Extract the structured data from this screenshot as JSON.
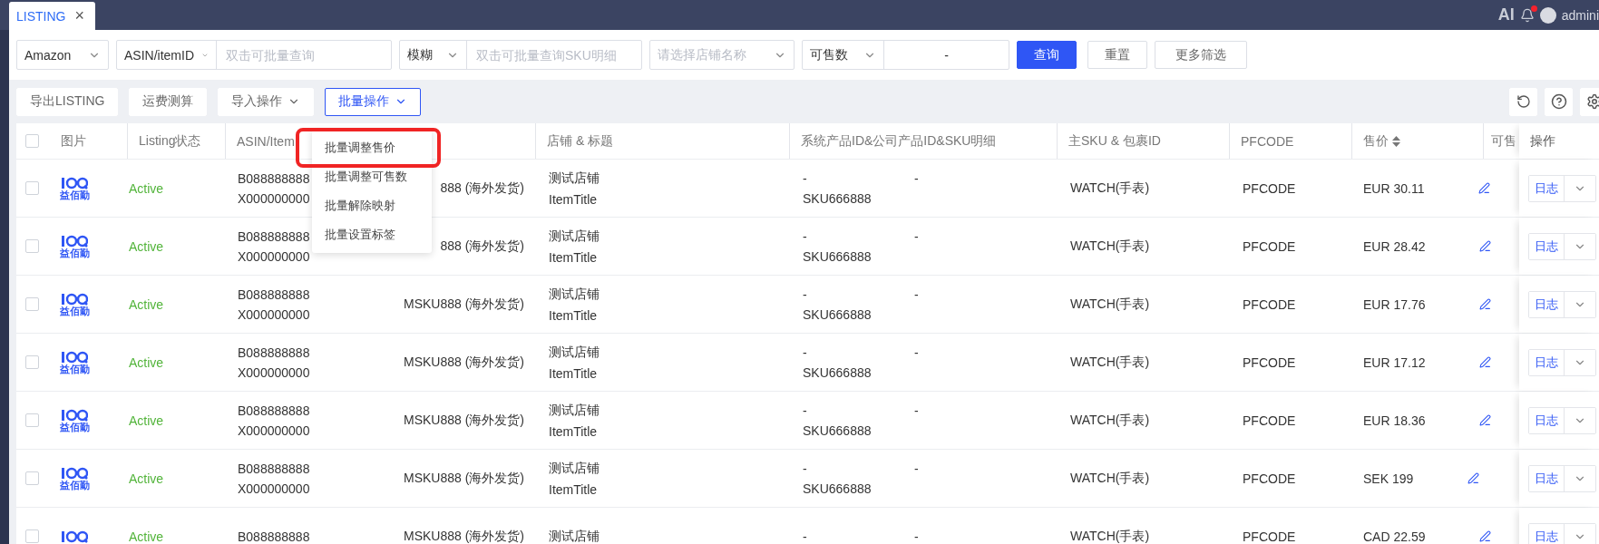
{
  "top_bar": {
    "tab": {
      "label": "LISTING",
      "close": "×",
      "selected": true
    },
    "ai_label": "AI",
    "notification_dot": true,
    "user": "admini"
  },
  "filters": [
    {
      "kind": "select",
      "value": "Amazon"
    },
    {
      "kind": "select_input",
      "select": "ASIN/itemID",
      "placeholder": "双击可批量查询"
    },
    {
      "kind": "select_input",
      "select": "模糊",
      "placeholder": "双击可批量查询SKU明细"
    },
    {
      "kind": "select",
      "placeholder": "请选择店铺名称"
    },
    {
      "kind": "range",
      "select": "可售数",
      "separator": "-"
    }
  ],
  "filter_buttons": [
    {
      "label": "查询",
      "kind": "primary"
    },
    {
      "label": "重置",
      "kind": "default"
    },
    {
      "label": "更多筛选",
      "kind": "default"
    }
  ],
  "toolbar": [
    {
      "label": "导出LISTING",
      "kind": "plain"
    },
    {
      "label": "运费测算",
      "kind": "plain"
    },
    {
      "label": "导入操作",
      "kind": "menu",
      "open": false
    },
    {
      "label": "批量操作",
      "kind": "menu",
      "open": true
    }
  ],
  "batch_menu": [
    {
      "label": "批量调整售价",
      "highlighted": true
    },
    {
      "label": "批量调整可售数",
      "highlighted": false
    },
    {
      "label": "批量解除映射",
      "highlighted": false
    },
    {
      "label": "批量设置标签",
      "highlighted": false
    }
  ],
  "table": {
    "columns": [
      {
        "kind": "checkbox",
        "checked": false
      },
      {
        "kind": "text",
        "label": "图片"
      },
      {
        "kind": "text",
        "label": "Listing状态"
      },
      {
        "kind": "text",
        "label": "ASIN/Item"
      },
      {
        "kind": "blank"
      },
      {
        "kind": "text",
        "label": "店铺 & 标题"
      },
      {
        "kind": "text",
        "label": "系统产品ID&公司产品ID&SKU明细"
      },
      {
        "kind": "text",
        "label": "主SKU & 包裹ID"
      },
      {
        "kind": "text",
        "label": "PFCODE"
      },
      {
        "kind": "sortable",
        "label": "售价"
      },
      {
        "kind": "text",
        "label": "可售"
      },
      {
        "kind": "fixed",
        "label": "操作"
      }
    ],
    "rows": [
      {
        "checked": false,
        "logo_text": "益佰勤",
        "status": "Active",
        "asin": "B088888888",
        "item_id": "X000000000",
        "msku": "888 (海外发货)",
        "store": "测试店铺",
        "title": "ItemTitle",
        "system_id": "-",
        "company_id": "-",
        "sku": "SKU666888",
        "main_sku": "WATCH(手表)",
        "pfcode": "PFCODE",
        "price": "EUR 30.11",
        "action": "日志"
      },
      {
        "checked": false,
        "logo_text": "益佰勤",
        "status": "Active",
        "asin": "B088888888",
        "item_id": "X000000000",
        "msku": "888 (海外发货)",
        "store": "测试店铺",
        "title": "ItemTitle",
        "system_id": "-",
        "company_id": "-",
        "sku": "SKU666888",
        "main_sku": "WATCH(手表)",
        "pfcode": "PFCODE",
        "price": "EUR 28.42",
        "action": "日志"
      },
      {
        "checked": false,
        "logo_text": "益佰勤",
        "status": "Active",
        "asin": "B088888888",
        "item_id": "X000000000",
        "msku": "MSKU888 (海外发货)",
        "store": "测试店铺",
        "title": "ItemTitle",
        "system_id": "-",
        "company_id": "-",
        "sku": "SKU666888",
        "main_sku": "WATCH(手表)",
        "pfcode": "PFCODE",
        "price": "EUR 17.76",
        "action": "日志"
      },
      {
        "checked": false,
        "logo_text": "益佰勤",
        "status": "Active",
        "asin": "B088888888",
        "item_id": "X000000000",
        "msku": "MSKU888 (海外发货)",
        "store": "测试店铺",
        "title": "ItemTitle",
        "system_id": "-",
        "company_id": "-",
        "sku": "SKU666888",
        "main_sku": "WATCH(手表)",
        "pfcode": "PFCODE",
        "price": "EUR 17.12",
        "action": "日志"
      },
      {
        "checked": false,
        "logo_text": "益佰勤",
        "status": "Active",
        "asin": "B088888888",
        "item_id": "X000000000",
        "msku": "MSKU888 (海外发货)",
        "store": "测试店铺",
        "title": "ItemTitle",
        "system_id": "-",
        "company_id": "-",
        "sku": "SKU666888",
        "main_sku": "WATCH(手表)",
        "pfcode": "PFCODE",
        "price": "EUR 18.36",
        "action": "日志"
      },
      {
        "checked": false,
        "logo_text": "益佰勤",
        "status": "Active",
        "asin": "B088888888",
        "item_id": "X000000000",
        "msku": "MSKU888 (海外发货)",
        "store": "测试店铺",
        "title": "ItemTitle",
        "system_id": "-",
        "company_id": "-",
        "sku": "SKU666888",
        "main_sku": "WATCH(手表)",
        "pfcode": "PFCODE",
        "price": "SEK 199",
        "action": "日志"
      },
      {
        "checked": false,
        "status": "Active",
        "asin": "B088888888",
        "msku": "MSKU888 (海外发货)",
        "store": "测试店铺",
        "system_id": "-",
        "company_id": "-",
        "main_sku": "WATCH(手表)",
        "pfcode": "PFCODE",
        "price": "CAD 22.59",
        "action": "日志"
      }
    ]
  }
}
